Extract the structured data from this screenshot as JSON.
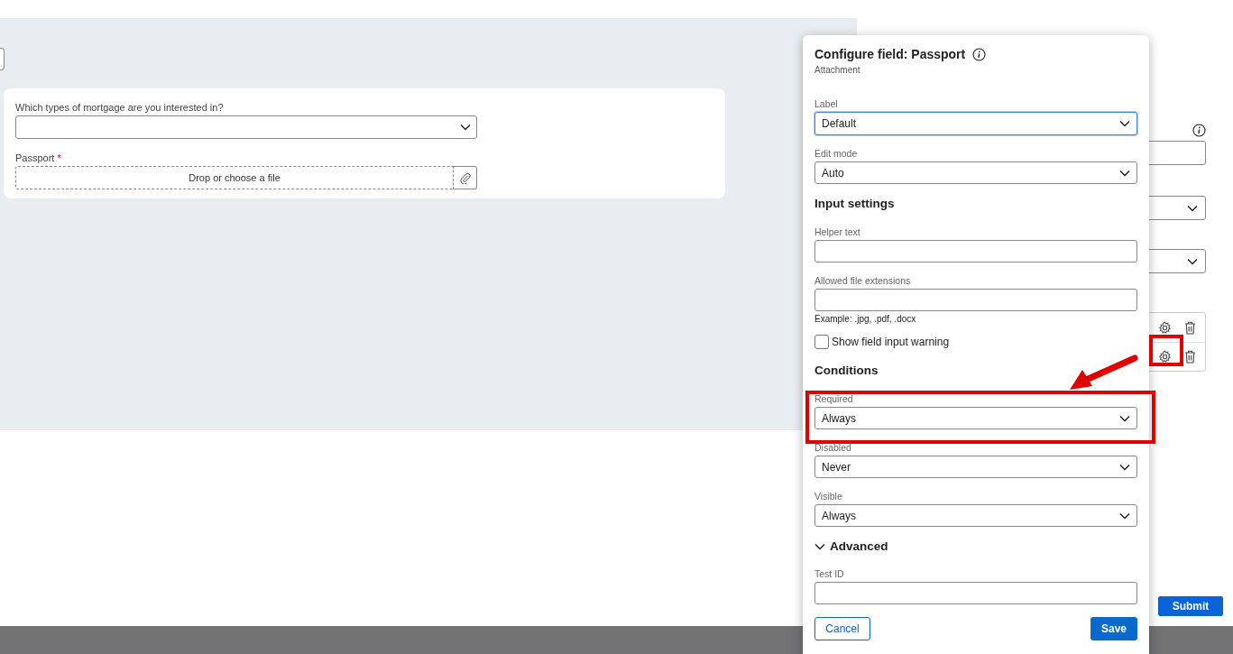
{
  "form": {
    "fields": [
      {
        "kind": "select",
        "label": "Which types of mortgage are you interested in?"
      },
      {
        "kind": "file",
        "label": "Passport",
        "required_mark": "*",
        "placeholder": "Drop or choose a file"
      }
    ]
  },
  "side_panel": {
    "rows": [
      {
        "kind": "field-row"
      },
      {
        "kind": "field-row"
      }
    ],
    "submit": "Submit"
  },
  "dialog": {
    "title": "Configure field: Passport",
    "subtitle": "Attachment",
    "items": [
      {
        "kind": "select",
        "label": "Label",
        "value": "Default",
        "focused": true
      },
      {
        "kind": "select",
        "label": "Edit mode",
        "value": "Auto",
        "focused": false
      },
      {
        "kind": "heading",
        "text": "Input settings"
      },
      {
        "kind": "text",
        "label": "Helper text"
      },
      {
        "kind": "text",
        "label": "Allowed file extensions",
        "hint": "Example: .jpg, .pdf, .docx"
      },
      {
        "kind": "checkbox",
        "label": "Show field input warning",
        "checked": false
      },
      {
        "kind": "heading",
        "text": "Conditions"
      },
      {
        "kind": "select",
        "label": "Required",
        "value": "Always",
        "focused": false
      },
      {
        "kind": "select",
        "label": "Disabled",
        "value": "Never",
        "focused": false
      },
      {
        "kind": "select",
        "label": "Visible",
        "value": "Always",
        "focused": false
      },
      {
        "kind": "expander",
        "text": "Advanced",
        "expanded": true
      },
      {
        "kind": "text",
        "label": "Test ID"
      }
    ],
    "cancel": "Cancel",
    "save": "Save"
  },
  "annotations": [
    {
      "kind": "box"
    },
    {
      "kind": "box"
    },
    {
      "kind": "arrow"
    }
  ]
}
